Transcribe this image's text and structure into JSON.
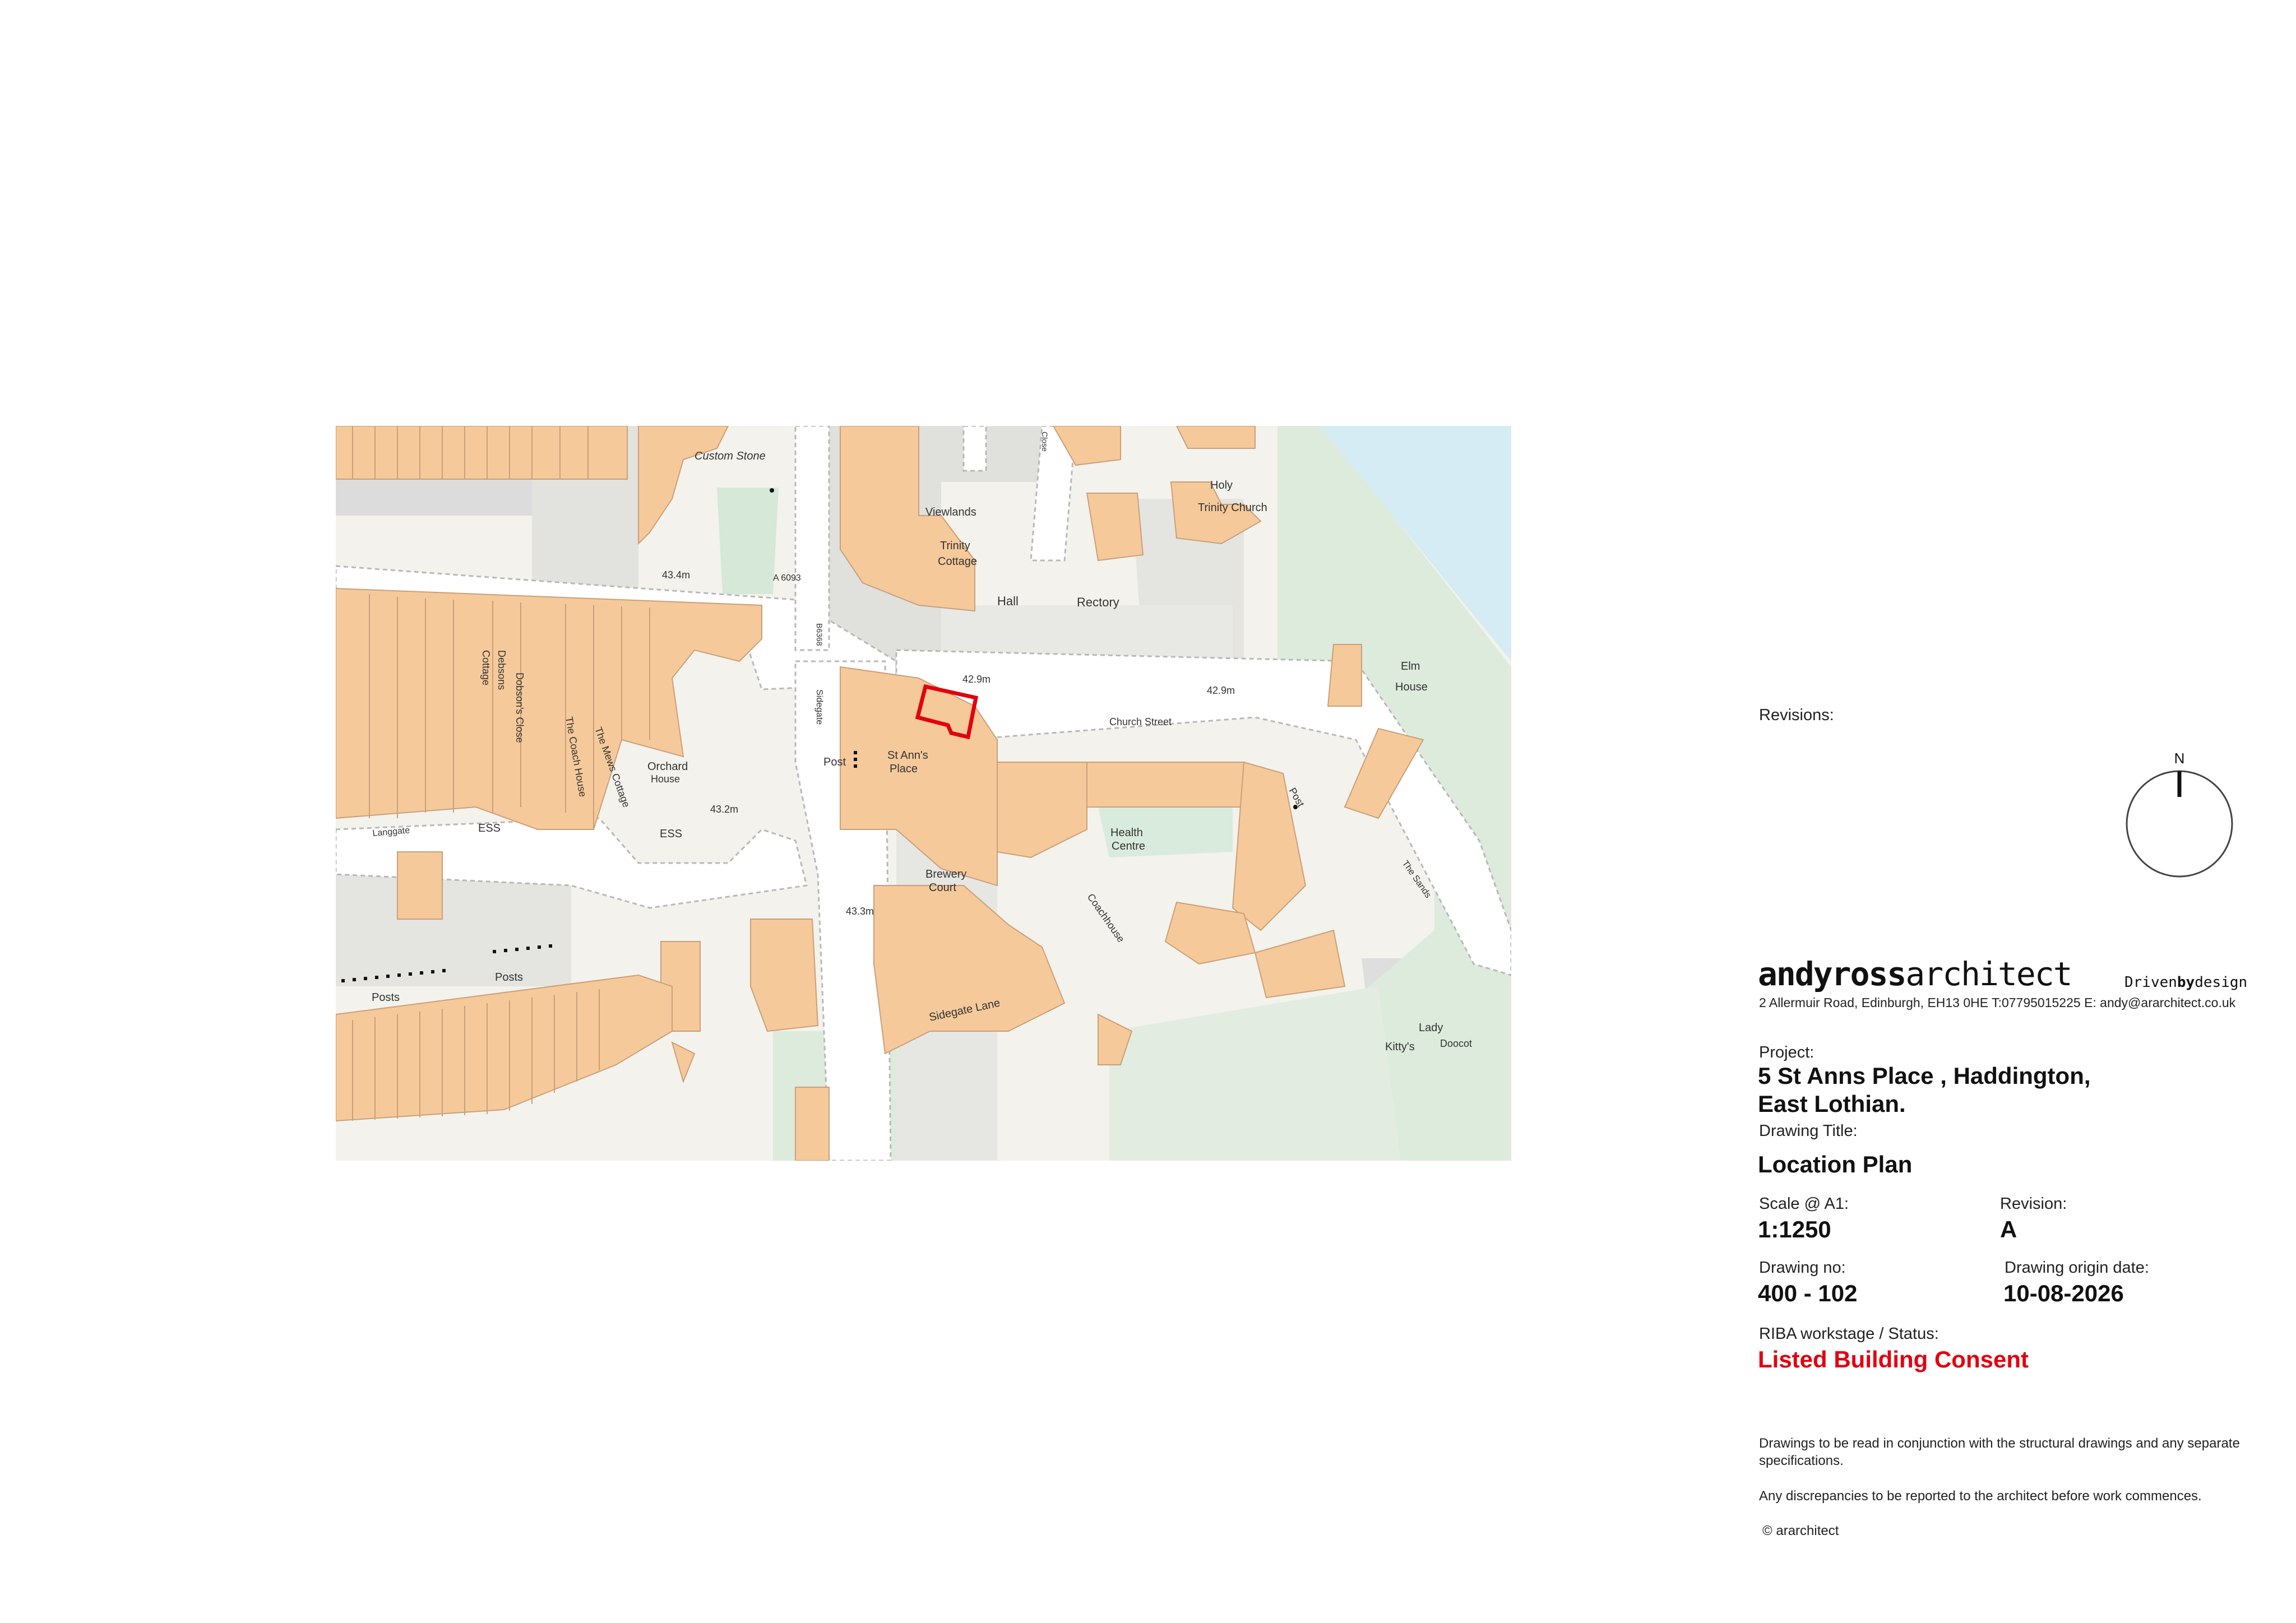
{
  "titleblock": {
    "revisions_label": "Revisions:",
    "north_label": "N",
    "brand_bold": "andyross",
    "brand_light": "architect",
    "tagline_a": "Driven",
    "tagline_b": "by",
    "tagline_c": "design",
    "address": "2 Allermuir Road, Edinburgh, EH13 0HE T:07795015225 E: andy@ararchitect.co.uk",
    "project_label": "Project:",
    "project_line1": "5 St Anns Place , Haddington,",
    "project_line2": "East Lothian.",
    "drawing_title_label": "Drawing Title:",
    "drawing_title": "Location Plan",
    "scale_label": "Scale @ A1:",
    "scale": "1:1250",
    "revision_label": "Revision:",
    "revision": "A",
    "drawing_no_label": "Drawing no:",
    "drawing_no": "400 - 102",
    "origin_date_label": "Drawing origin date:",
    "origin_date": "10-08-2026",
    "status_label": "RIBA workstage / Status:",
    "status": "Listed Building Consent",
    "note1": "Drawings to be read in conjunction with the structural drawings and any separate specifications.",
    "note2": "Any discrepancies to be reported to the architect before work commences.",
    "copyright": "© ararchitect",
    "status_color": "#e2000f"
  },
  "map": {
    "labels": {
      "custom_stone": "Custom Stone",
      "viewlands": "Viewlands",
      "trinity": "Trinity",
      "cottage": "Cottage",
      "hall": "Hall",
      "holy": "Holy",
      "trinity_church": "Trinity Church",
      "rectory": "Rectory",
      "elm": "Elm",
      "house": "House",
      "church_street": "Church Street",
      "st_anns": "St Ann's",
      "place": "Place",
      "post": "Post",
      "health": "Health",
      "centre": "Centre",
      "brewery": "Brewery",
      "court": "Court",
      "coachhouse": "Coachhouse",
      "sidegate_lane": "Sidegate Lane",
      "lady": "Lady",
      "doocot": "Doocot",
      "kittys": "Kitty's",
      "posts_1": "Posts",
      "posts_2": "Posts",
      "ess_1": "ESS",
      "ess_2": "ESS",
      "orchard": "Orchard",
      "orchard_house": "House",
      "debsons": "Debsons",
      "cottage_v": "Cottage",
      "dobsons_close": "Dobson's Close",
      "coach_house": "The Coach House",
      "mews_cottage": "The Mews Cottage",
      "langgate": "Langgate",
      "sidegate": "Sidegate",
      "the_sands": "The Sands",
      "a6093": "A 6093",
      "b6368": "B6368",
      "lev_434": "43.4m",
      "lev_429a": "42.9m",
      "lev_429b": "42.9m",
      "lev_432": "43.2m",
      "lev_433": "43.3m",
      "post_v": "Post",
      "close": "Close"
    },
    "colors": {
      "building": "#f5c99a",
      "building_edge": "#caa07a",
      "background": "#f3f2ec",
      "road": "#ffffff",
      "grey_area": "#dcdcdc",
      "green_area": "#dcebdc",
      "water": "#d6ecf4",
      "site_outline": "#e2000f"
    }
  }
}
